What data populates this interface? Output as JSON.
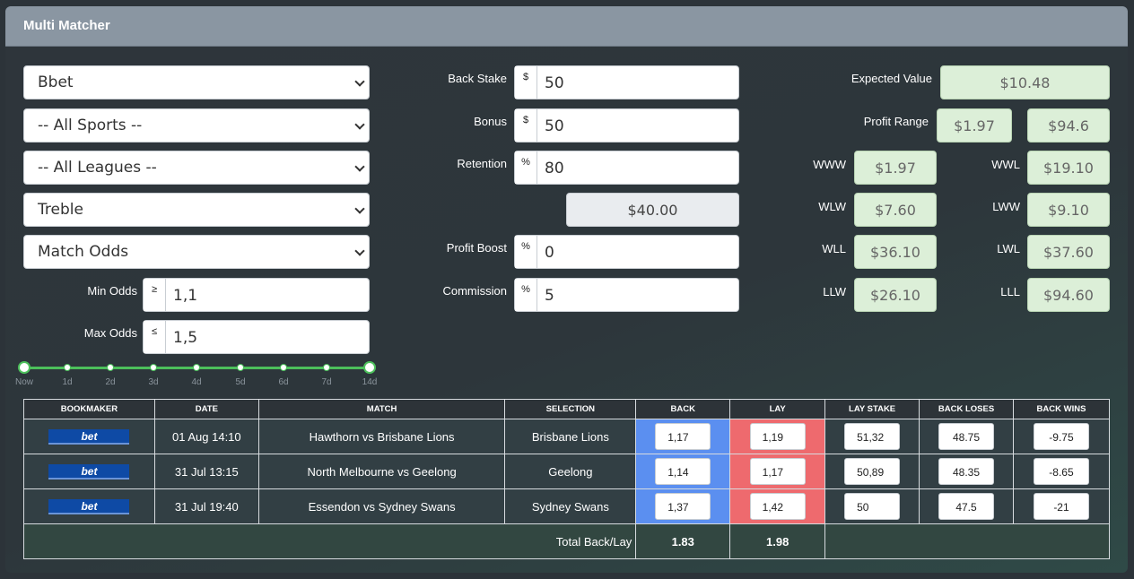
{
  "header": {
    "title": "Multi Matcher"
  },
  "filters": {
    "bookmaker": "Bbet",
    "sport": "-- All Sports --",
    "league": "-- All Leagues --",
    "bet_type": "Treble",
    "market": "Match Odds",
    "min_odds_label": "Min Odds",
    "min_odds_symbol": "≥",
    "min_odds": "1,1",
    "max_odds_label": "Max Odds",
    "max_odds_symbol": "≤",
    "max_odds": "1,5"
  },
  "slider": {
    "ticks": [
      "Now",
      "1d",
      "2d",
      "3d",
      "4d",
      "5d",
      "6d",
      "7d",
      "14d"
    ]
  },
  "stakes": {
    "back_stake_label": "Back Stake",
    "back_stake_symbol": "$",
    "back_stake": "50",
    "bonus_label": "Bonus",
    "bonus_symbol": "$",
    "bonus": "50",
    "retention_label": "Retention",
    "retention_symbol": "%",
    "retention": "80",
    "retention_value": "$40.00",
    "profit_boost_label": "Profit Boost",
    "profit_boost_symbol": "%",
    "profit_boost": "0",
    "commission_label": "Commission",
    "commission_symbol": "%",
    "commission": "5"
  },
  "results": {
    "expected_value_label": "Expected Value",
    "expected_value": "$10.48",
    "profit_range_label": "Profit Range",
    "profit_range_min": "$1.97",
    "profit_range_max": "$94.6",
    "outcomes": [
      {
        "label": "WWW",
        "value": "$1.97"
      },
      {
        "label": "WWL",
        "value": "$19.10"
      },
      {
        "label": "WLW",
        "value": "$7.60"
      },
      {
        "label": "LWW",
        "value": "$9.10"
      },
      {
        "label": "WLL",
        "value": "$36.10"
      },
      {
        "label": "LWL",
        "value": "$37.60"
      },
      {
        "label": "LLW",
        "value": "$26.10"
      },
      {
        "label": "LLL",
        "value": "$94.60"
      }
    ]
  },
  "table": {
    "headers": [
      "BOOKMAKER",
      "DATE",
      "MATCH",
      "SELECTION",
      "BACK",
      "LAY",
      "LAY STAKE",
      "BACK LOSES",
      "BACK WINS"
    ],
    "rows": [
      {
        "bookmaker": "bet",
        "date": "01 Aug 14:10",
        "match": "Hawthorn vs Brisbane Lions",
        "selection": "Brisbane Lions",
        "back": "1,17",
        "lay": "1,19",
        "lay_stake": "51,32",
        "back_loses": "48.75",
        "back_wins": "-9.75"
      },
      {
        "bookmaker": "bet",
        "date": "31 Jul 13:15",
        "match": "North Melbourne vs Geelong",
        "selection": "Geelong",
        "back": "1,14",
        "lay": "1,17",
        "lay_stake": "50,89",
        "back_loses": "48.35",
        "back_wins": "-8.65"
      },
      {
        "bookmaker": "bet",
        "date": "31 Jul 19:40",
        "match": "Essendon vs Sydney Swans",
        "selection": "Sydney Swans",
        "back": "1,37",
        "lay": "1,42",
        "lay_stake": "50",
        "back_loses": "47.5",
        "back_wins": "-21"
      }
    ],
    "total_label": "Total Back/Lay",
    "total_back": "1.83",
    "total_lay": "1.98"
  },
  "colors": {
    "back": "#5b8ff0",
    "lay": "#ee6a6e",
    "accent": "#4cc05b"
  }
}
